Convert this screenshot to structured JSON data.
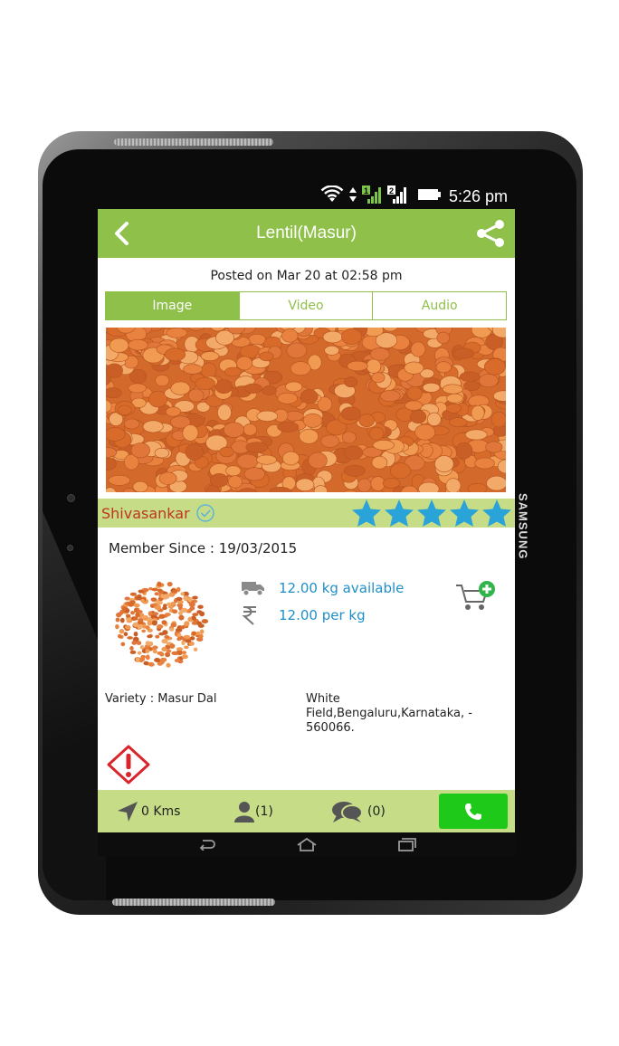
{
  "device": {
    "brand": "SAMSUNG"
  },
  "status_bar": {
    "time": "5:26 pm",
    "sim1": "1",
    "sim2": "2"
  },
  "app_bar": {
    "title": "Lentil(Masur)",
    "back_icon": "back-arrow-icon",
    "share_icon": "share-icon"
  },
  "posted": "Posted on Mar 20 at 02:58 pm",
  "media_tabs": [
    {
      "label": "Image",
      "active": true
    },
    {
      "label": "Video",
      "active": false
    },
    {
      "label": "Audio",
      "active": false
    }
  ],
  "seller": {
    "name": "Shivasankar",
    "verified": true,
    "rating": 5,
    "rating_max": 5
  },
  "member_since": "Member Since : 19/03/2015",
  "product": {
    "available": "12.00 kg available",
    "price": "12.00 per kg",
    "variety": "Variety : Masur Dal",
    "address": "White Field,Bengaluru,Karnataka, - 560066."
  },
  "bottom_bar": {
    "distance": "0 Kms",
    "users": "(1)",
    "comments": "(0)"
  },
  "colors": {
    "green": "#8fc04a",
    "light_green": "#c6dc87",
    "seller_red": "#c0351f",
    "info_blue": "#1f8fc7",
    "call_green": "#1fc91a",
    "star_blue": "#2aa3d8"
  }
}
